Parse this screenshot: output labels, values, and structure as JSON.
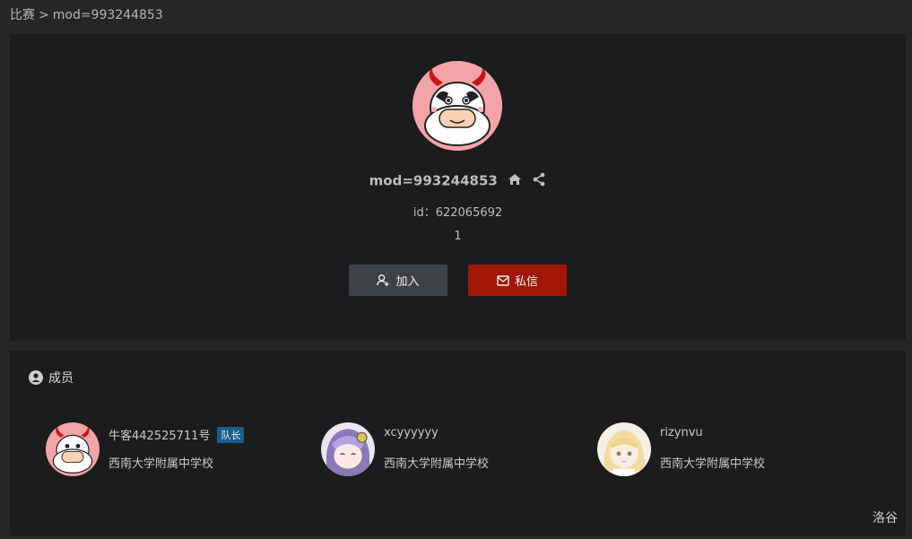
{
  "breadcrumb": {
    "parent": "比赛",
    "separator": ">",
    "current": "mod=993244853"
  },
  "team": {
    "name": "mod=993244853",
    "id_text": "id：622065692",
    "count": "1"
  },
  "actions": {
    "join_label": "加入",
    "message_label": "私信"
  },
  "members_section": {
    "title": "成员"
  },
  "members": [
    {
      "name": "牛客442525711号",
      "badge": "队长",
      "school": "西南大学附属中学校",
      "avatar": "cow-avatar"
    },
    {
      "name": "xcyyyyyy",
      "badge": "",
      "school": "西南大学附属中学校",
      "avatar": "anime-purple-avatar"
    },
    {
      "name": "rizynvu",
      "badge": "",
      "school": "西南大学附属中学校",
      "avatar": "anime-blonde-avatar"
    }
  ],
  "footer": {
    "logo_text": "洛谷"
  },
  "colors": {
    "message_button": "#a11606",
    "join_button": "#3e4244",
    "badge": "#1a5f8c",
    "avatar_bg": "#f4a3a8"
  }
}
